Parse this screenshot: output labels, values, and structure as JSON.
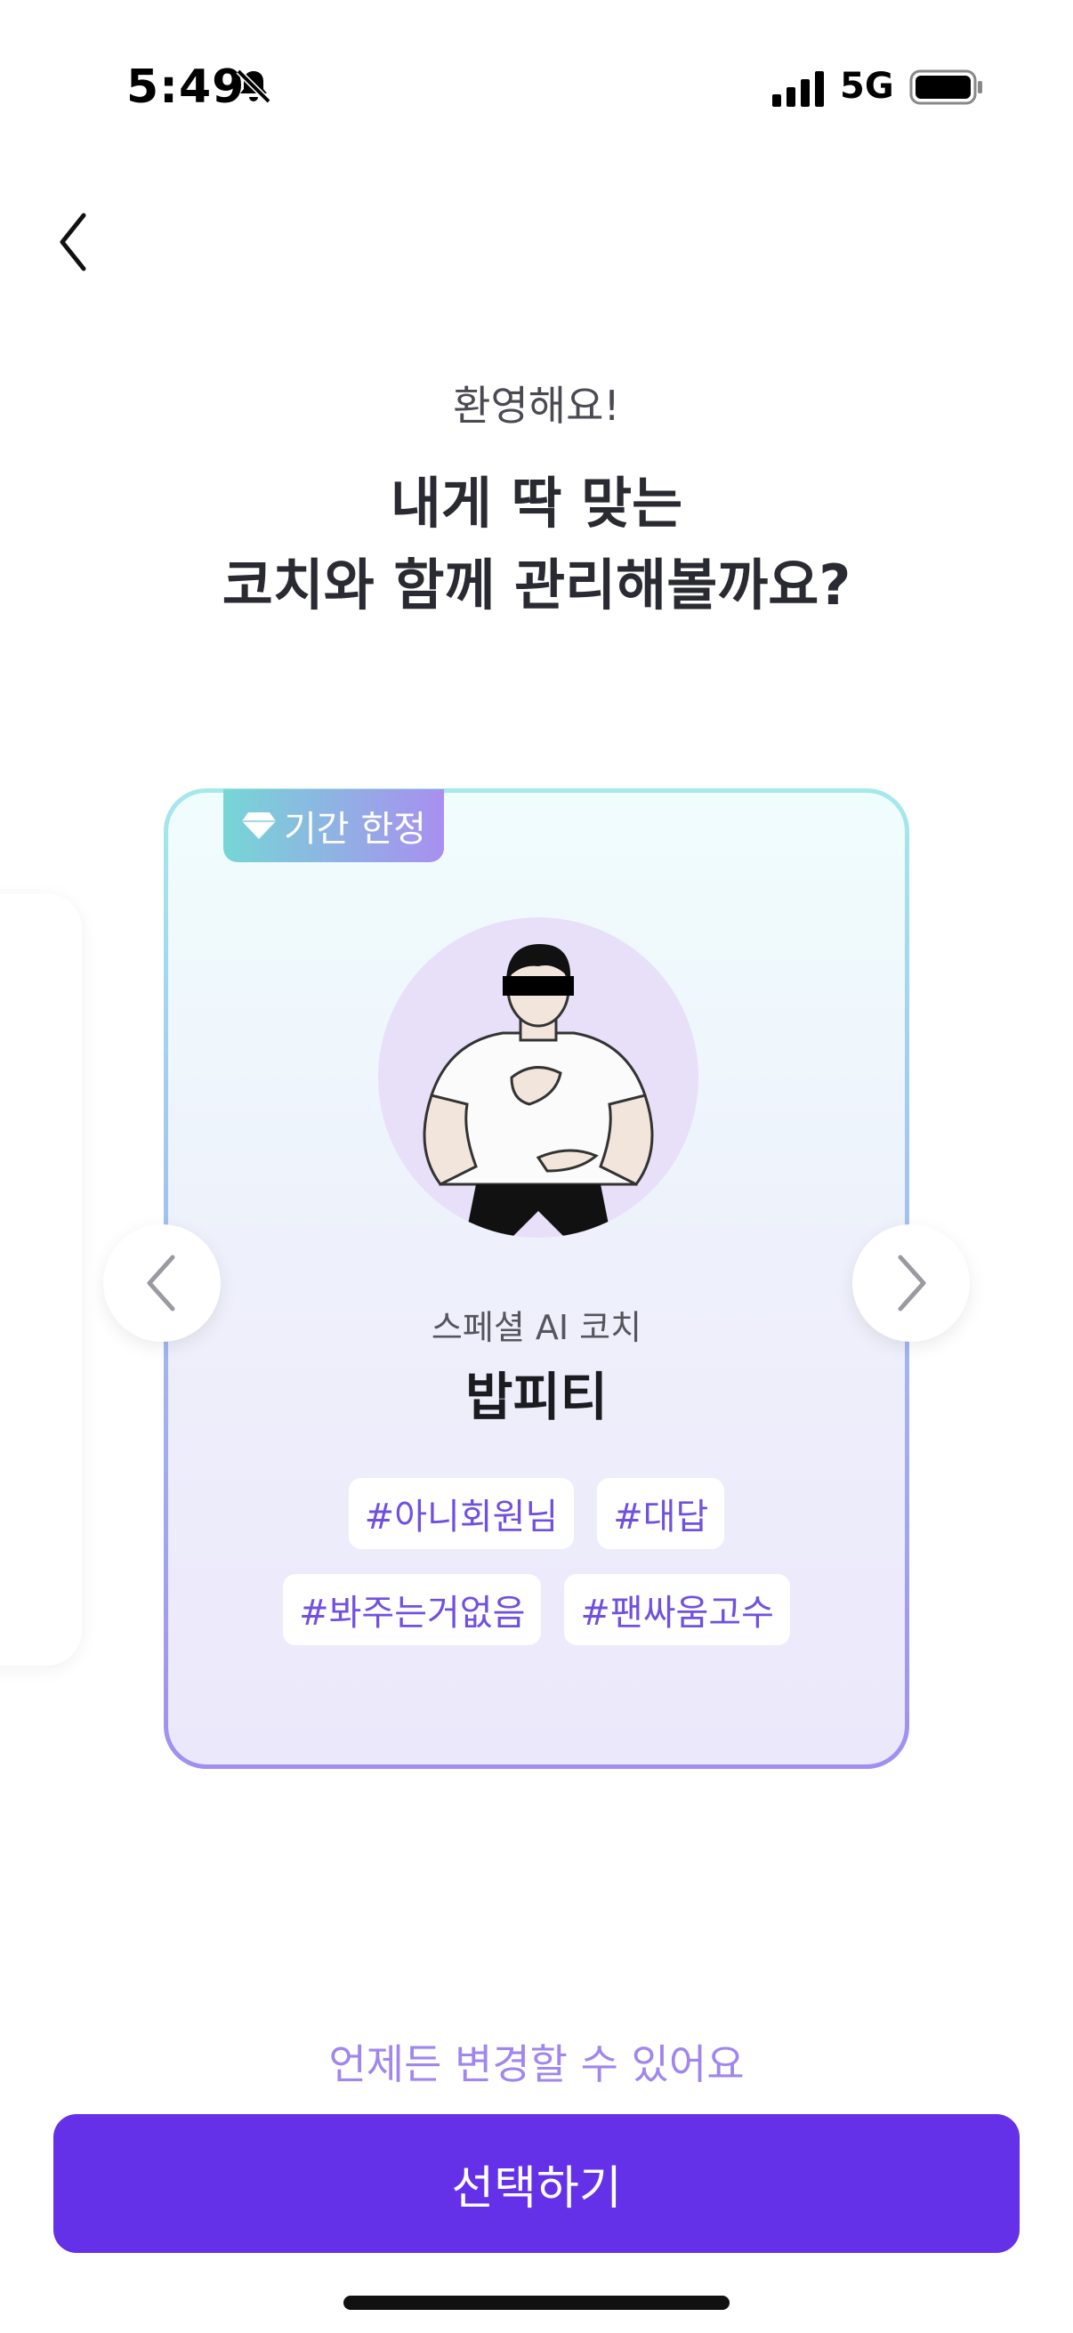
{
  "status_bar": {
    "time": "5:49",
    "network": "5G"
  },
  "header": {
    "welcome": "환영해요!",
    "headline_line1": "내게 딱 맞는",
    "headline_line2": "코치와 함께 관리해볼까요?"
  },
  "coach_card": {
    "badge": "기간 한정",
    "subtitle": "스페셜 AI 코치",
    "name": "밥피티",
    "tags": [
      "#아니회원님",
      "#대답",
      "#봐주는거없음",
      "#팬싸움고수"
    ]
  },
  "footer": {
    "note": "언제든 변경할 수 있어요",
    "select_label": "선택하기"
  },
  "icons": {
    "back": "chevron-left-icon",
    "prev": "chevron-left-icon",
    "next": "chevron-right-icon",
    "badge": "diamond-icon",
    "silent": "bell-slash-icon"
  },
  "colors": {
    "accent": "#6531e8",
    "tag_text": "#7150e0",
    "note": "#a086ee"
  }
}
